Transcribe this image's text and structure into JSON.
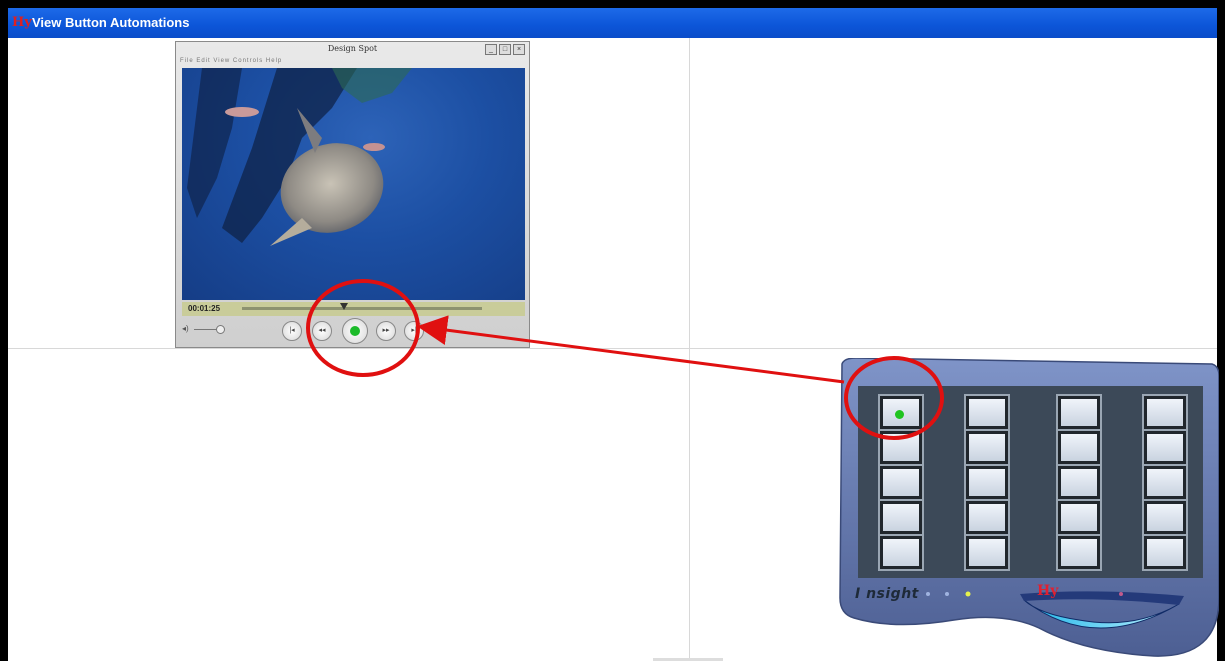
{
  "window": {
    "title": "View Button Automations",
    "logo_text": "Hy"
  },
  "player": {
    "title": "Design Spot",
    "menu": "File  Edit  View  Controls  Help",
    "time": "00:01:25",
    "progress": 0.42,
    "volume": 0.8,
    "buttons": [
      "|<<",
      "<<",
      "play",
      ">>",
      ">|"
    ]
  },
  "controller": {
    "brand": "I nsight",
    "logo_text": "Hy",
    "columns": 4,
    "rows": 5,
    "active_button": {
      "column": 1,
      "row": 1
    },
    "body_color": "#5b6fa6",
    "led_color": "#1fc41f"
  },
  "annotation": {
    "circle_color": "#e01010",
    "arrow_color": "#e01010"
  }
}
